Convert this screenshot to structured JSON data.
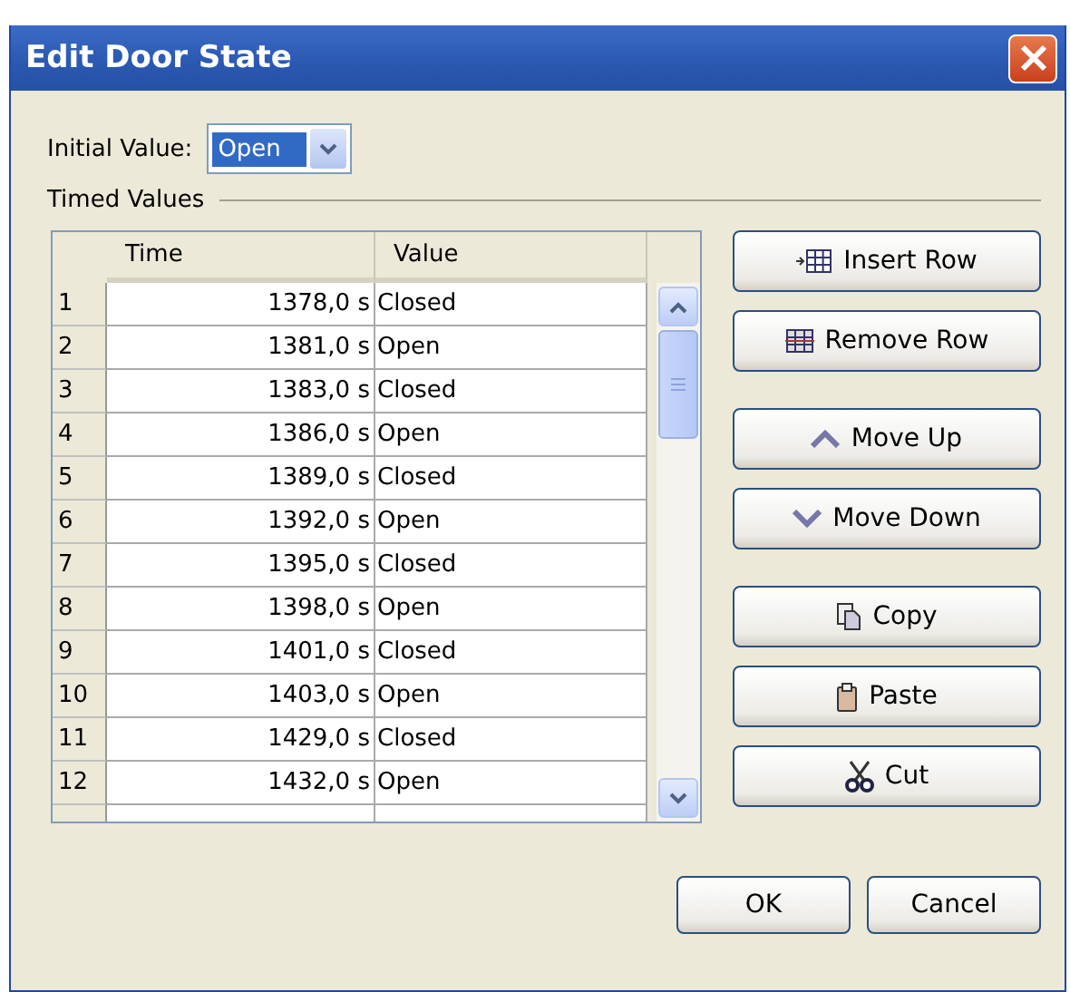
{
  "window": {
    "title": "Edit Door State"
  },
  "initial_value": {
    "label": "Initial Value:",
    "value": "Open"
  },
  "timed_values": {
    "title": "Timed Values",
    "columns": [
      "Time",
      "Value"
    ],
    "rows": [
      {
        "index": "1",
        "time": "1378,0 s",
        "value": "Closed"
      },
      {
        "index": "2",
        "time": "1381,0 s",
        "value": "Open"
      },
      {
        "index": "3",
        "time": "1383,0 s",
        "value": "Closed"
      },
      {
        "index": "4",
        "time": "1386,0 s",
        "value": "Open"
      },
      {
        "index": "5",
        "time": "1389,0 s",
        "value": "Closed"
      },
      {
        "index": "6",
        "time": "1392,0 s",
        "value": "Open"
      },
      {
        "index": "7",
        "time": "1395,0 s",
        "value": "Closed"
      },
      {
        "index": "8",
        "time": "1398,0 s",
        "value": "Open"
      },
      {
        "index": "9",
        "time": "1401,0 s",
        "value": "Closed"
      },
      {
        "index": "10",
        "time": "1403,0 s",
        "value": "Open"
      },
      {
        "index": "11",
        "time": "1429,0 s",
        "value": "Closed"
      },
      {
        "index": "12",
        "time": "1432,0 s",
        "value": "Open"
      }
    ]
  },
  "side_button_groups": [
    [
      {
        "label": "Insert Row",
        "kind": "insert"
      },
      {
        "label": "Remove Row",
        "kind": "remove"
      }
    ],
    [
      {
        "label": "Move Up",
        "kind": "up"
      },
      {
        "label": "Move Down",
        "kind": "down"
      }
    ],
    [
      {
        "label": "Copy",
        "kind": "copy"
      },
      {
        "label": "Paste",
        "kind": "paste"
      },
      {
        "label": "Cut",
        "kind": "cut"
      }
    ]
  ],
  "buttons": [
    "OK",
    "Cancel"
  ]
}
